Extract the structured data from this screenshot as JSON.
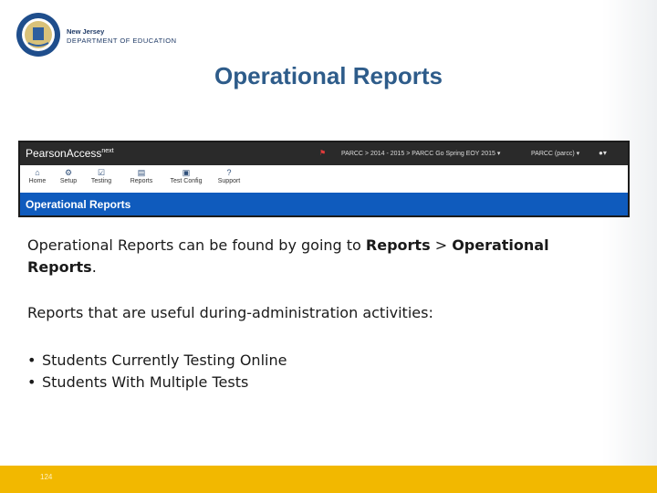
{
  "header": {
    "org_line1": "New Jersey",
    "org_line2": "DEPARTMENT OF EDUCATION"
  },
  "slide_title": "Operational Reports",
  "screenshot": {
    "brand": "PearsonAccess",
    "brand_sup": "next",
    "breadcrumb": "PARCC > 2014 - 2015 > PARCC Go Spring EOY 2015 ▾",
    "user": "PARCC (parcc) ▾",
    "nav_items": [
      {
        "label": "Home",
        "icon": "home-icon",
        "glyph": "⌂"
      },
      {
        "label": "Setup",
        "icon": "gear-icon",
        "glyph": "⚙"
      },
      {
        "label": "Testing",
        "icon": "check-icon",
        "glyph": "☑"
      },
      {
        "label": "Reports",
        "icon": "reports-icon",
        "glyph": "▤"
      },
      {
        "label": "Test Config",
        "icon": "config-icon",
        "glyph": "▣"
      },
      {
        "label": "Support",
        "icon": "help-icon",
        "glyph": "?"
      }
    ],
    "section_label": "Operational Reports"
  },
  "body": {
    "p1_pre": "Operational Reports can be found by going to ",
    "p1_bold1": "Reports",
    "p1_mid": " > ",
    "p1_bold2": "Operational Reports",
    "p1_end": ".",
    "p2": "Reports that are useful during-administration activities:",
    "bullets": [
      "Students Currently Testing Online",
      "Students With Multiple Tests"
    ]
  },
  "footer": {
    "page_number": "124"
  },
  "colors": {
    "title": "#2e5c8a",
    "footer": "#f2b800",
    "bluebar": "#0f5bbd"
  }
}
